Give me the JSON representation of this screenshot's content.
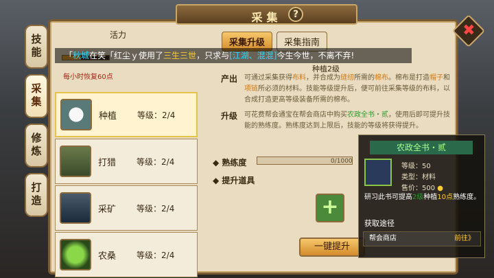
{
  "title": "采集",
  "help_icon": "?",
  "close_icon": "✖",
  "side_tabs": [
    "技能",
    "采集",
    "修炼",
    "打造"
  ],
  "activity_label": "活力",
  "recover_text": "每小时恢复60点",
  "ticker": {
    "prefix": "「",
    "name": "秋城",
    "t1": "在笑「红尘ｙ使用了",
    "hl1": "三生三世",
    "t2": "，只求与",
    "hl2": "[江湖、混混]",
    "t3": "今生今世，不离不弃!"
  },
  "items": [
    {
      "name": "种植",
      "level_label": "等级：",
      "level_value": "2/4",
      "active": true
    },
    {
      "name": "打猎",
      "level_label": "等级：",
      "level_value": "2/4",
      "active": false
    },
    {
      "name": "采矿",
      "level_label": "等级：",
      "level_value": "2/4",
      "active": false
    },
    {
      "name": "农桑",
      "level_label": "等级：",
      "level_value": "2/4",
      "active": false
    }
  ],
  "tabs": [
    "采集升级",
    "采集指南"
  ],
  "level_title": "种植2级",
  "output_label": "产出",
  "output_text_1": "可通过采集获得",
  "output_hl1": "布料",
  "output_text_2": "，并合成为",
  "output_hl2": "缝纫",
  "output_text_3": "所需的",
  "output_hl3": "棉布",
  "output_text_4": "。棉布是打造",
  "output_hl4": "帽子",
  "output_text_5": "和",
  "output_hl5": "项链",
  "output_text_6": "所必须的材料。技能等级提升后，便可前往采集等级的布料，以合成打造更高等级装备所需的棉布。",
  "upgrade_label": "升级",
  "upgrade_text_1": "可花费帮会通宝在帮会商店中购买",
  "upgrade_hl": "农政全书・贰",
  "upgrade_text_2": "，使用后即可提升技能的熟练度。熟练度达到上限后，技能的等级将获得提升。",
  "proficiency_label": "熟练度",
  "proficiency_value": "0/1000",
  "proficiency_ratio": 0,
  "upgrade_item_label": "提升道具",
  "upgrade_button": "一键提升",
  "tooltip": {
    "title": "农政全书・贰",
    "level": "等级：50",
    "type": "类型：材料",
    "price_label": "售价：",
    "price": "500",
    "desc_1": "研习此书可提高",
    "desc_hl1": "2级",
    "desc_2": "种植",
    "desc_hl2": "10点",
    "desc_3": "熟练度。",
    "source_label": "获取途径",
    "source": "帮会商店",
    "goto": "前往》"
  },
  "colors": {
    "accent": "#d48b2c",
    "highlight_yellow": "#ffcc33",
    "highlight_cyan": "#2fd8ff",
    "green": "#2c9a2a"
  }
}
